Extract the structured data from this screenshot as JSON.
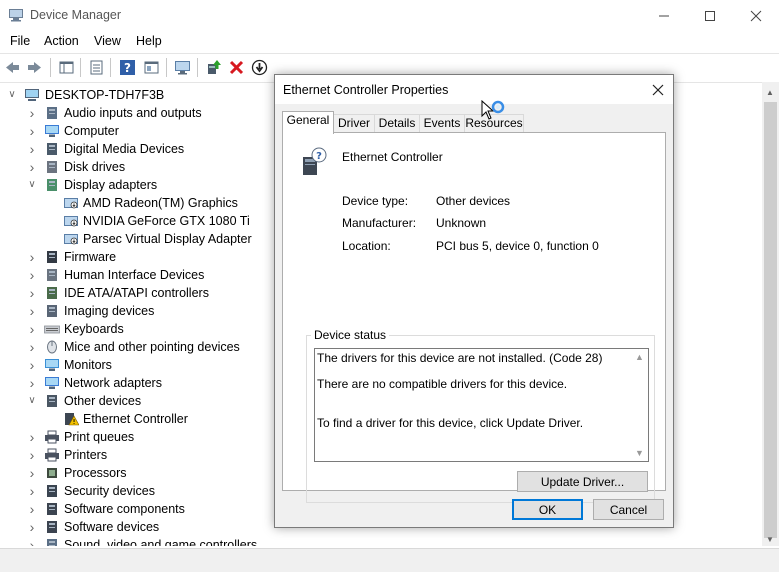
{
  "window": {
    "title": "Device Manager"
  },
  "menu": [
    "File",
    "Action",
    "View",
    "Help"
  ],
  "tree": {
    "root": "DESKTOP-TDH7F3B",
    "items": [
      {
        "label": "Audio inputs and outputs",
        "icon": "speaker-icon"
      },
      {
        "label": "Computer",
        "icon": "computer-icon"
      },
      {
        "label": "Digital Media Devices",
        "icon": "media-device-icon"
      },
      {
        "label": "Disk drives",
        "icon": "disk-drive-icon"
      },
      {
        "label": "Display adapters",
        "icon": "display-adapter-icon"
      },
      {
        "label": "AMD Radeon(TM) Graphics",
        "icon": "display-adapter-icon"
      },
      {
        "label": "NVIDIA GeForce GTX 1080 Ti",
        "icon": "display-adapter-icon"
      },
      {
        "label": "Parsec Virtual Display Adapter",
        "icon": "display-adapter-icon"
      },
      {
        "label": "Firmware",
        "icon": "firmware-icon"
      },
      {
        "label": "Human Interface Devices",
        "icon": "hid-icon"
      },
      {
        "label": "IDE ATA/ATAPI controllers",
        "icon": "ide-controller-icon"
      },
      {
        "label": "Imaging devices",
        "icon": "camera-icon"
      },
      {
        "label": "Keyboards",
        "icon": "keyboard-icon"
      },
      {
        "label": "Mice and other pointing devices",
        "icon": "mouse-icon"
      },
      {
        "label": "Monitors",
        "icon": "monitor-icon"
      },
      {
        "label": "Network adapters",
        "icon": "network-adapter-icon"
      },
      {
        "label": "Other devices",
        "icon": "unknown-device-icon"
      },
      {
        "label": "Ethernet Controller",
        "icon": "warning-device-icon"
      },
      {
        "label": "Print queues",
        "icon": "printer-icon"
      },
      {
        "label": "Printers",
        "icon": "printer-icon"
      },
      {
        "label": "Processors",
        "icon": "processor-icon"
      },
      {
        "label": "Security devices",
        "icon": "security-device-icon"
      },
      {
        "label": "Software components",
        "icon": "software-component-icon"
      },
      {
        "label": "Software devices",
        "icon": "software-device-icon"
      },
      {
        "label": "Sound, video and game controllers",
        "icon": "sound-icon"
      }
    ]
  },
  "dialog": {
    "title": "Ethernet Controller Properties",
    "tabs": [
      "General",
      "Driver",
      "Details",
      "Events",
      "Resources"
    ],
    "active_tab": "General",
    "device_name": "Ethernet Controller",
    "props": [
      {
        "label": "Device type:",
        "value": "Other devices"
      },
      {
        "label": "Manufacturer:",
        "value": "Unknown"
      },
      {
        "label": "Location:",
        "value": "PCI bus 5, device 0, function 0"
      }
    ],
    "status_group": "Device status",
    "status_lines": [
      "The drivers for this device are not installed. (Code 28)",
      "There are no compatible drivers for this device.",
      "To find a driver for this device, click Update Driver."
    ],
    "update_button": "Update Driver...",
    "ok_button": "OK",
    "cancel_button": "Cancel"
  },
  "colors": {
    "accent": "#0078d7",
    "warning": "#f2c100",
    "error": "#d71920"
  }
}
